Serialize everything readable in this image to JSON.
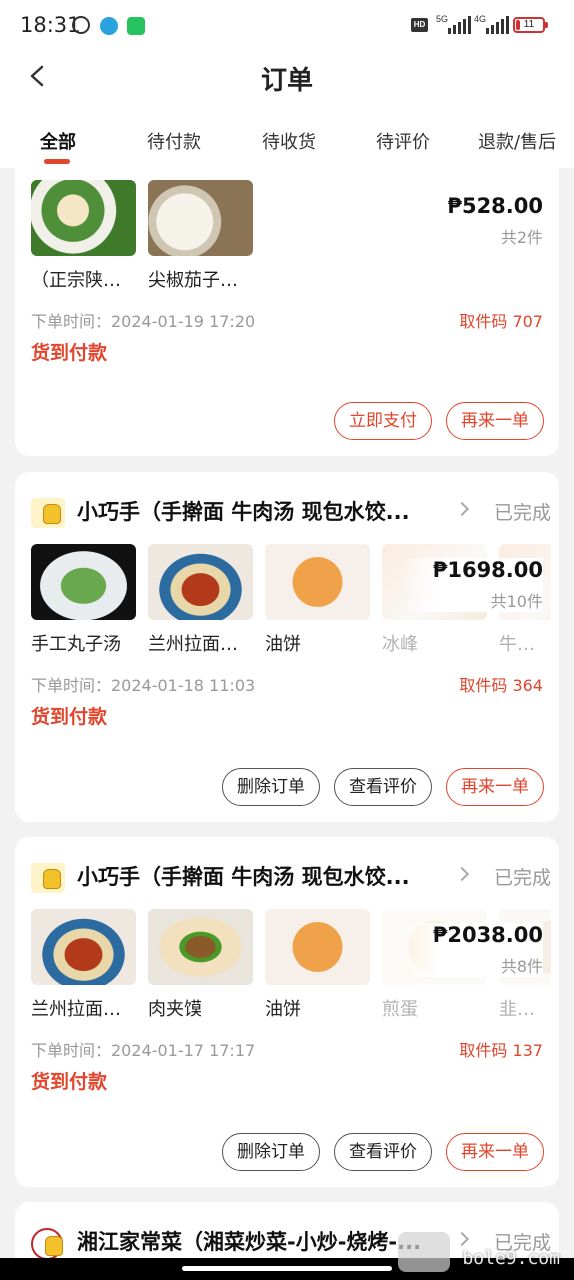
{
  "status_bar": {
    "time": "18:31",
    "network_label_1": "5G",
    "network_label_2": "4G",
    "hd_label": "HD",
    "battery": "11"
  },
  "header": {
    "title": "订单",
    "tabs": [
      {
        "label": "全部"
      },
      {
        "label": "待付款"
      },
      {
        "label": "待收货"
      },
      {
        "label": "待评价"
      },
      {
        "label": "退款/售后"
      }
    ]
  },
  "orders": [
    {
      "items": [
        {
          "name": "（正宗陕西油泼扯面）"
        },
        {
          "name": "尖椒茄子包子"
        }
      ],
      "price": "₱528.00",
      "count": "共2件",
      "order_time": "下单时间：2024-01-19 17:20",
      "pickup_code": "取件码 707",
      "payment": "货到付款",
      "buttons": [
        "立即支付",
        "再来一单"
      ]
    },
    {
      "shop_name": "小巧手（手擀面 牛肉汤 现包水饺...",
      "status": "已完成",
      "items": [
        {
          "name": "手工丸子汤"
        },
        {
          "name": "兰州拉面牛肉面"
        },
        {
          "name": "油饼"
        },
        {
          "name": "冰峰"
        },
        {
          "name": "牛肉饼"
        }
      ],
      "price": "₱1698.00",
      "count": "共10件",
      "order_time": "下单时间：2024-01-18 11:03",
      "pickup_code": "取件码 364",
      "payment": "货到付款",
      "buttons": [
        "删除订单",
        "查看评价",
        "再来一单"
      ]
    },
    {
      "shop_name": "小巧手（手擀面 牛肉汤 现包水饺...",
      "status": "已完成",
      "items": [
        {
          "name": "兰州拉面牛肉面"
        },
        {
          "name": "肉夹馍"
        },
        {
          "name": "油饼"
        },
        {
          "name": "煎蛋"
        },
        {
          "name": "韭菜盒子"
        }
      ],
      "price": "₱2038.00",
      "count": "共8件",
      "order_time": "下单时间：2024-01-17 17:17",
      "pickup_code": "取件码 137",
      "payment": "货到付款",
      "buttons": [
        "删除订单",
        "查看评价",
        "再来一单"
      ]
    },
    {
      "shop_name": "湘江家常菜（湘菜炒菜-小炒-烧烤-...",
      "status": "已完成"
    }
  ],
  "watermark": "bole9.com",
  "colors": {
    "accent": "#e2452c",
    "muted": "#999999",
    "background": "#f2f2f2"
  }
}
